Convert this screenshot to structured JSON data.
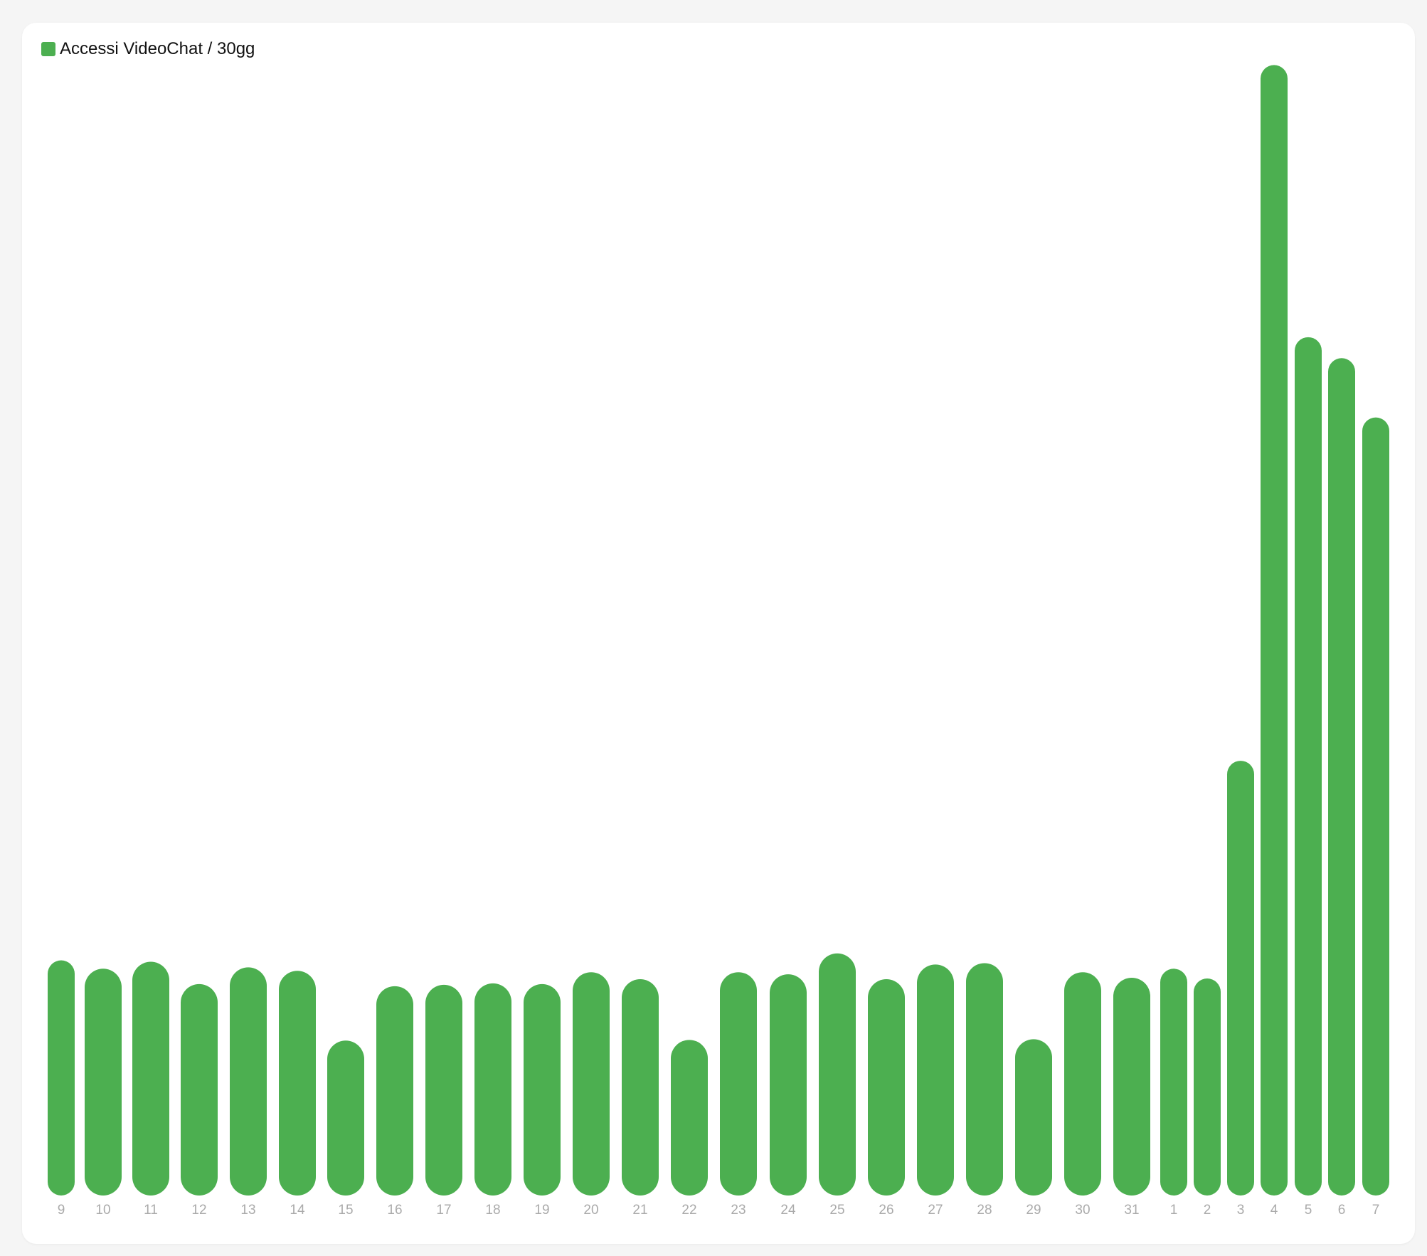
{
  "chart_data": {
    "type": "bar",
    "legend": {
      "label": "Accessi VideoChat / 30gg",
      "color": "#4caf50",
      "placement": "top-left"
    },
    "title": "",
    "xlabel": "",
    "ylabel": "",
    "grid": false,
    "bar_color": "#4caf50",
    "tick_color": "#aaaaaa",
    "categories": [
      "9",
      "10",
      "11",
      "12",
      "13",
      "14",
      "15",
      "16",
      "17",
      "18",
      "19",
      "20",
      "21",
      "22",
      "23",
      "24",
      "25",
      "26",
      "27",
      "28",
      "29",
      "30",
      "31",
      "1",
      "2",
      "3",
      "4",
      "5",
      "6",
      "7"
    ],
    "values": [
      337,
      325,
      335,
      303,
      327,
      322,
      222,
      300,
      302,
      304,
      303,
      320,
      310,
      223,
      320,
      317,
      347,
      310,
      331,
      333,
      224,
      320,
      312,
      325,
      311,
      623,
      1620,
      1230,
      1200,
      1115
    ],
    "ylim": [
      0,
      1650
    ]
  }
}
